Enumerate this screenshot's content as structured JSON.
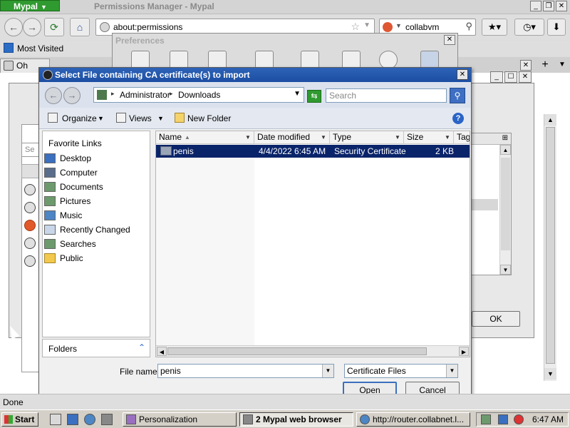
{
  "browser": {
    "app_button": "Mypal",
    "window_title": "Permissions Manager - Mypal",
    "url": "about:permissions",
    "search_text": "collabvm",
    "bookmark": "Most Visited",
    "tab_label": "Oh noes!",
    "status": "Done"
  },
  "page": {
    "heading": "Pe",
    "search_placeholder": "Se",
    "ok_label": "OK"
  },
  "preferences": {
    "title": "Preferences"
  },
  "file_dialog": {
    "title": "Select File containing CA certificate(s) to import",
    "breadcrumb": [
      "Administrator",
      "Downloads"
    ],
    "search_placeholder": "Search",
    "toolbar": {
      "organize": "Organize",
      "views": "Views",
      "new_folder": "New Folder"
    },
    "favorites_title": "Favorite Links",
    "favorites": [
      {
        "label": "Desktop",
        "icon": "desktop-icon"
      },
      {
        "label": "Computer",
        "icon": "computer-icon"
      },
      {
        "label": "Documents",
        "icon": "documents-icon"
      },
      {
        "label": "Pictures",
        "icon": "pictures-icon"
      },
      {
        "label": "Music",
        "icon": "music-icon"
      },
      {
        "label": "Recently Changed",
        "icon": "recent-icon"
      },
      {
        "label": "Searches",
        "icon": "searches-icon"
      },
      {
        "label": "Public",
        "icon": "public-folder-icon"
      }
    ],
    "folders_label": "Folders",
    "columns": [
      "Name",
      "Date modified",
      "Type",
      "Size",
      "Tag"
    ],
    "files": [
      {
        "name": "penis",
        "date": "4/4/2022 6:45 AM",
        "type": "Security Certificate",
        "size": "2 KB",
        "selected": true
      }
    ],
    "file_name_label": "File name:",
    "file_name_value": "penis",
    "filter": "Certificate Files",
    "open_label": "Open",
    "cancel_label": "Cancel"
  },
  "taskbar": {
    "start": "Start",
    "items": [
      {
        "label": "Personalization"
      },
      {
        "label": "2 Mypal web browser"
      },
      {
        "label": "http://router.collabnet.l..."
      }
    ],
    "clock": "6:47 AM"
  },
  "colors": {
    "selection": "#0a246a",
    "title_blue": "#1c4ea3",
    "app_green": "#2f9a2f"
  }
}
